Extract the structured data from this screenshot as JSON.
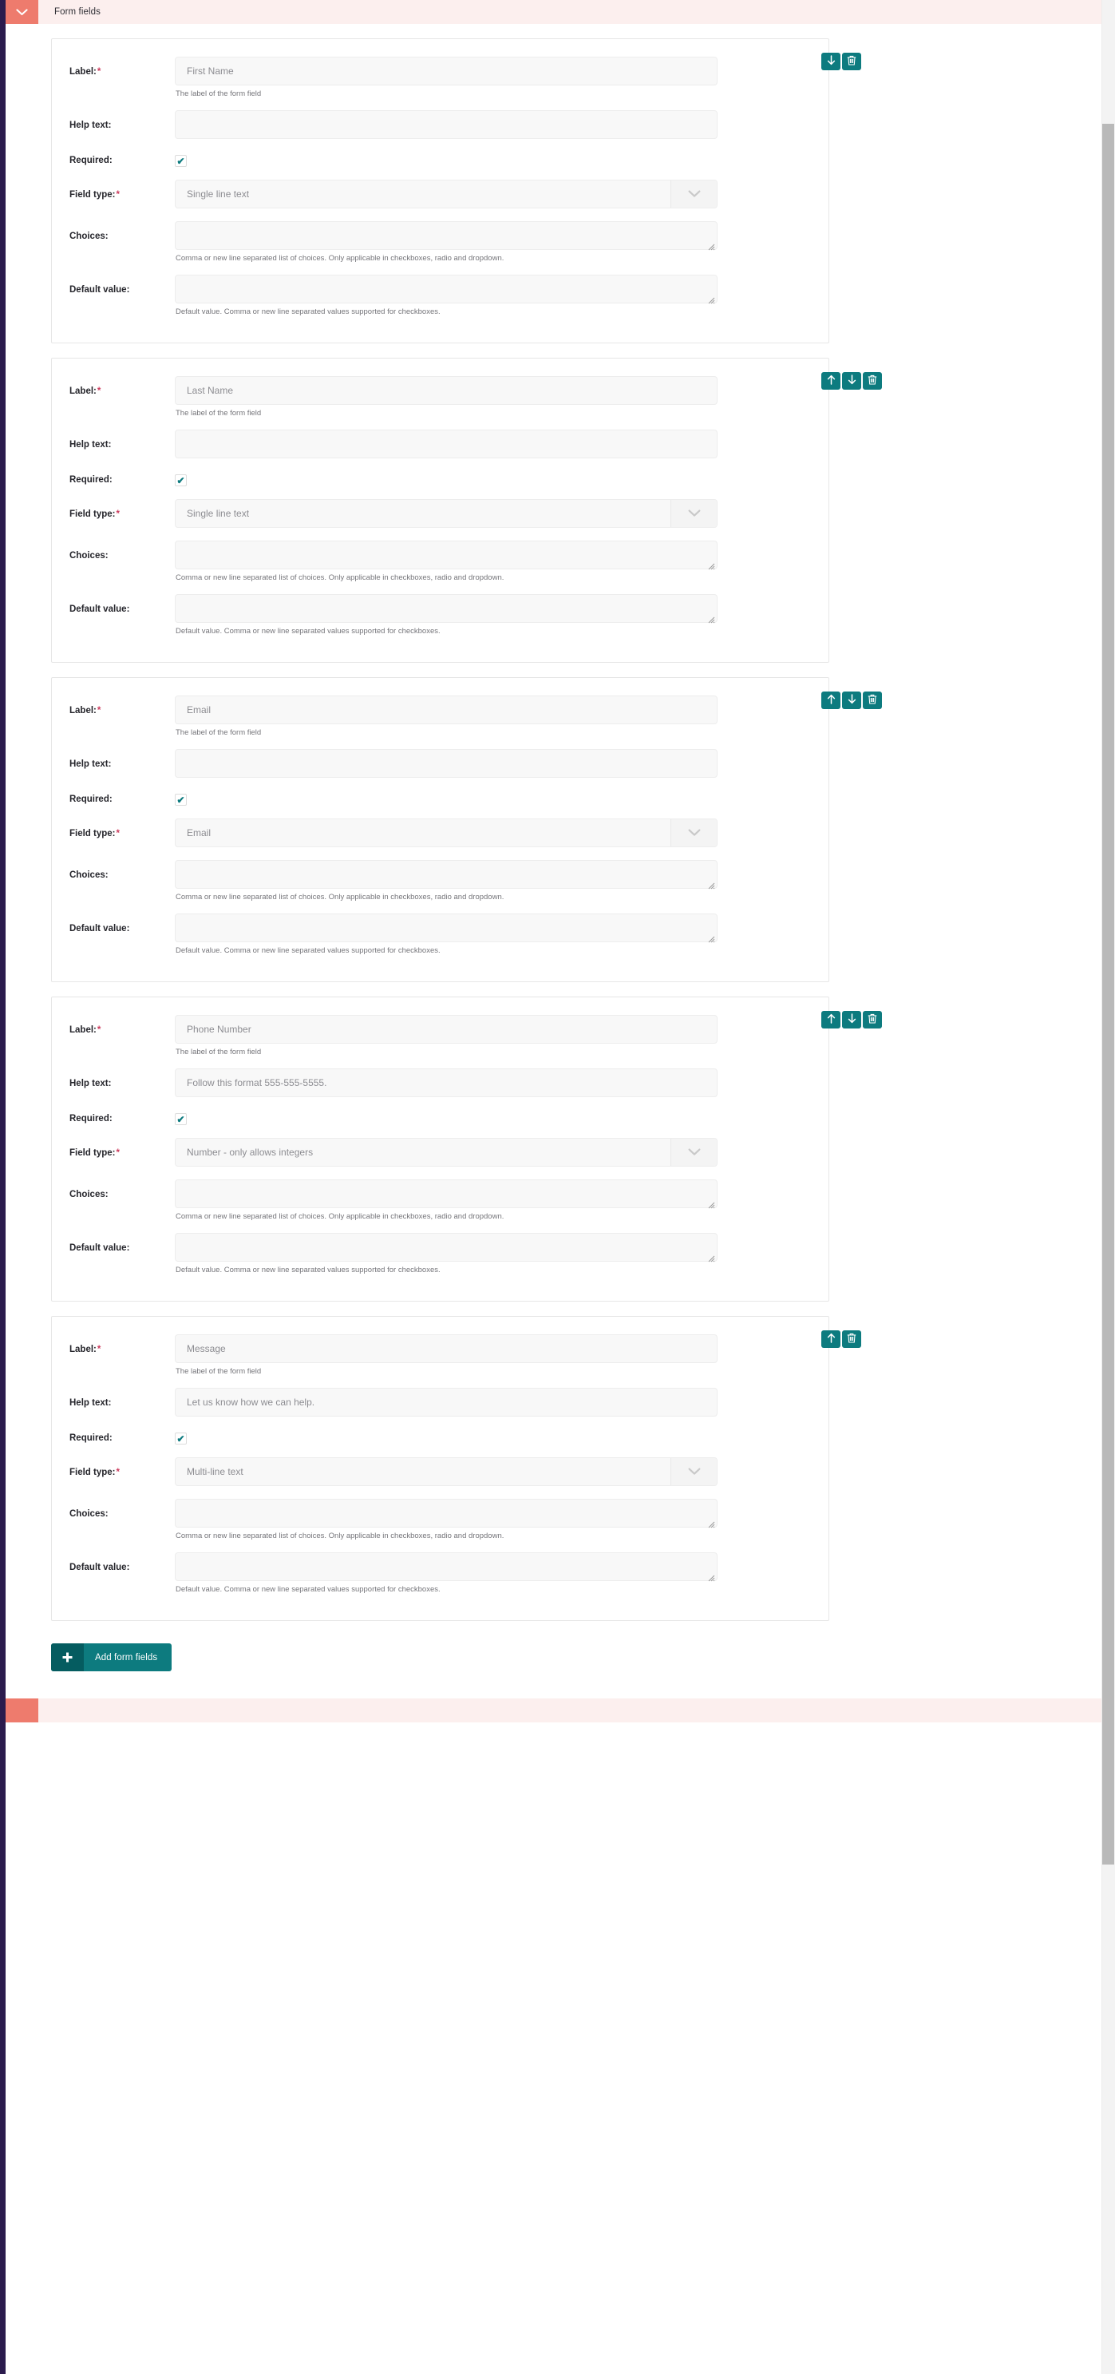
{
  "section": {
    "title": "Form fields",
    "toggle_icon": "chevron-down-icon",
    "accent_color": "#ee7b6d",
    "header_bg": "#fcefee"
  },
  "labels": {
    "label": "Label:",
    "help_text": "Help text:",
    "required": "Required:",
    "field_type": "Field type:",
    "choices": "Choices:",
    "default_value": "Default value:",
    "required_marker": "*"
  },
  "helpers": {
    "label": "The label of the form field",
    "choices": "Comma or new line separated list of choices. Only applicable in checkboxes, radio and dropdown.",
    "default_value": "Default value. Comma or new line separated values supported for checkboxes."
  },
  "actions": {
    "move_up_icon": "arrow-up-icon",
    "move_down_icon": "arrow-down-icon",
    "delete_icon": "trash-icon",
    "button_color": "#0d7b7f"
  },
  "add_button": {
    "label": "Add form fields",
    "icon": "plus-icon",
    "color": "#0d7b7f",
    "icon_box_color": "#055c60"
  },
  "checkbox": {
    "checked_glyph": "✔",
    "check_color": "#0d7b7f"
  },
  "cards": [
    {
      "label": "First Name",
      "help_text": "",
      "required": true,
      "field_type": "Single line text",
      "choices": "",
      "default_value": "",
      "can_move_up": false,
      "can_move_down": true
    },
    {
      "label": "Last Name",
      "help_text": "",
      "required": true,
      "field_type": "Single line text",
      "choices": "",
      "default_value": "",
      "can_move_up": true,
      "can_move_down": true
    },
    {
      "label": "Email",
      "help_text": "",
      "required": true,
      "field_type": "Email",
      "choices": "",
      "default_value": "",
      "can_move_up": true,
      "can_move_down": true
    },
    {
      "label": "Phone Number",
      "help_text": "Follow this format 555-555-5555.",
      "required": true,
      "field_type": "Number - only allows integers",
      "choices": "",
      "default_value": "",
      "can_move_up": true,
      "can_move_down": true
    },
    {
      "label": "Message",
      "help_text": "Let us know how we can help.",
      "required": true,
      "field_type": "Multi-line text",
      "choices": "",
      "default_value": "",
      "can_move_up": true,
      "can_move_down": false
    }
  ]
}
